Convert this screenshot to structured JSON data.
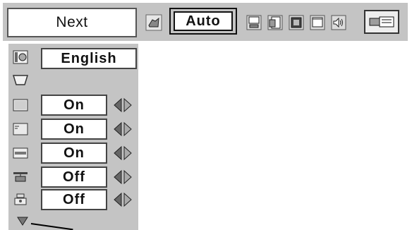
{
  "toolbar": {
    "next_label": "Next",
    "mode_value": "Auto",
    "icons": [
      "projector-setting-icon",
      "computer-icon",
      "document-icon",
      "image-icon",
      "screen-icon",
      "sound-icon",
      "lamp-icon"
    ]
  },
  "menu": {
    "language_value": "English",
    "rows": [
      {
        "icon": "screen-blank-icon",
        "value": "On"
      },
      {
        "icon": "display-icon",
        "value": "On"
      },
      {
        "icon": "logo-icon",
        "value": "On"
      },
      {
        "icon": "ceiling-icon",
        "value": "Off"
      },
      {
        "icon": "rear-icon",
        "value": "Off"
      }
    ]
  },
  "colors": {
    "panel": "#c4c4c4",
    "highlight_tab": "#c8c8c8"
  }
}
